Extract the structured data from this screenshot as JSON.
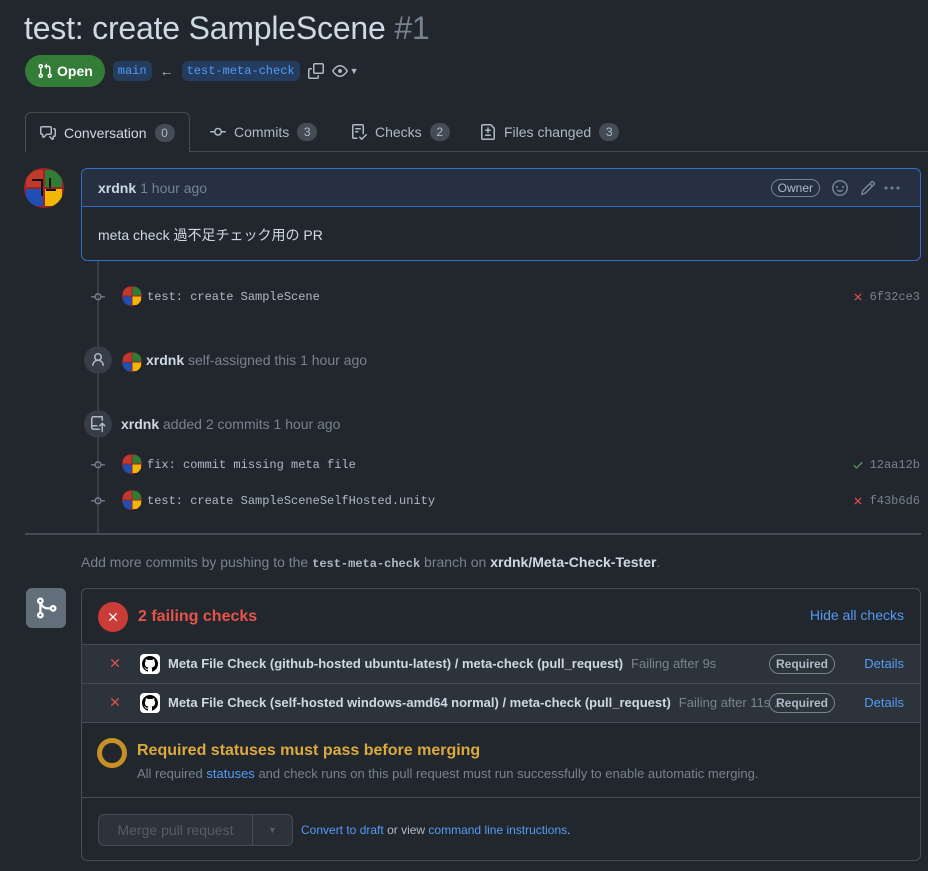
{
  "pr": {
    "title": "test: create SampleScene",
    "number": "#1",
    "state": "Open",
    "base_branch": "main",
    "head_branch": "test-meta-check"
  },
  "tabs": [
    {
      "label": "Conversation",
      "count": "0"
    },
    {
      "label": "Commits",
      "count": "3"
    },
    {
      "label": "Checks",
      "count": "2"
    },
    {
      "label": "Files changed",
      "count": "3"
    }
  ],
  "comment": {
    "author": "xrdnk",
    "time": "1 hour ago",
    "role": "Owner",
    "body": "meta check 過不足チェック用の PR"
  },
  "timeline": {
    "commit1": {
      "message": "test: create SampleScene",
      "sha": "6f32ce3",
      "status": "failure"
    },
    "assign": {
      "actor": "xrdnk",
      "text": "self-assigned this 1 hour ago"
    },
    "added": {
      "actor": "xrdnk",
      "text": "added 2 commits 1 hour ago"
    },
    "commit2": {
      "message": "fix: commit missing meta file",
      "sha": "12aa12b",
      "status": "success"
    },
    "commit3": {
      "message": "test: create SampleSceneSelfHosted.unity",
      "sha": "f43b6d6",
      "status": "failure"
    }
  },
  "hint": {
    "prefix": "Add more commits by pushing to the",
    "branch": "test-meta-check",
    "middle": "branch on",
    "repo": "xrdnk/Meta-Check-Tester",
    "suffix": "."
  },
  "checks": {
    "summary": "2 failing checks",
    "hide_label": "Hide all checks",
    "items": [
      {
        "name": "Meta File Check (github-hosted ubuntu-latest) / meta-check (pull_request)",
        "status": "Failing after 9s",
        "badge": "Required",
        "details": "Details"
      },
      {
        "name": "Meta File Check (self-hosted windows-amd64 normal) / meta-check (pull_request)",
        "status": "Failing after 11s ...",
        "badge": "Required",
        "details": "Details"
      }
    ]
  },
  "requirement": {
    "title": "Required statuses must pass before merging",
    "sub_prefix": "All required",
    "sub_link": "statuses",
    "sub_suffix": "and check runs on this pull request must run successfully to enable automatic merging."
  },
  "merge": {
    "button": "Merge pull request",
    "draft_link": "Convert to draft",
    "or_view": "or view",
    "cli_link": "command line instructions",
    "end": "."
  },
  "colors": {
    "open": "#347d39",
    "fail": "#e5534b",
    "success": "#57ab5a",
    "pending": "#c69026",
    "link": "#539bf5"
  }
}
